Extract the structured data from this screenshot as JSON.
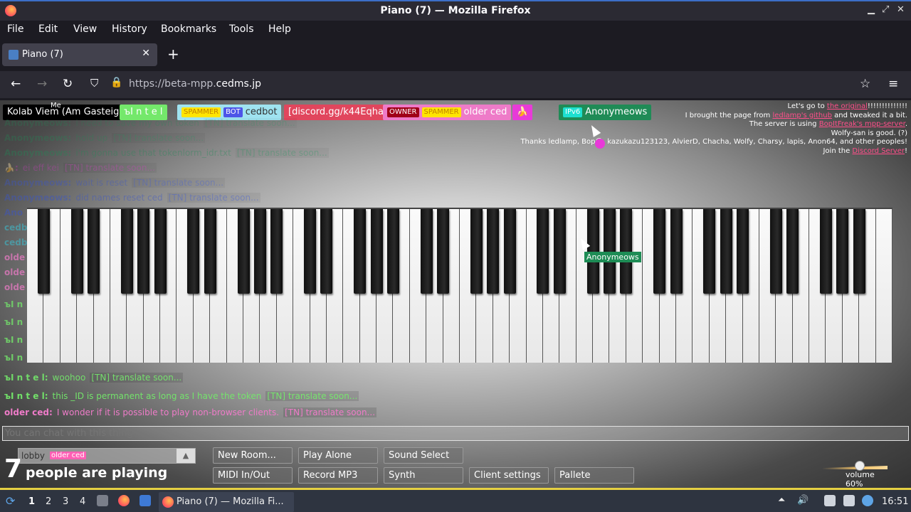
{
  "window": {
    "title": "Piano (7) — Mozilla Firefox"
  },
  "menu": [
    "File",
    "Edit",
    "View",
    "History",
    "Bookmarks",
    "Tools",
    "Help"
  ],
  "tab": {
    "label": "Piano (7)"
  },
  "url": {
    "prefix": "https://beta-mpp.",
    "domain": "cedms.jp"
  },
  "users": {
    "me_label": "Me",
    "list": [
      {
        "name": "Kolab Viem (Am Gasteig)",
        "tags": [],
        "bg": "#000000",
        "fg": "#ffffff"
      },
      {
        "name": "ъI n t e l",
        "tags": [],
        "bg": "#74e86b",
        "fg": "#ffffff"
      },
      {
        "name": "cedbot",
        "tags": [
          {
            "t": "SPAMMER",
            "bg": "#ffe500",
            "fg": "#c08000"
          },
          {
            "t": "BOT",
            "bg": "#4d55e8",
            "fg": "#ffffff"
          }
        ],
        "bg": "#9fe3f0",
        "fg": "#333333"
      },
      {
        "name": "[discord.gg/k44Eqha]",
        "tags": [],
        "bg": "#e1465d",
        "fg": "#ffffff"
      },
      {
        "name": "older ced",
        "tags": [
          {
            "t": "OWNER",
            "bg": "#a00018",
            "fg": "#ffffff"
          },
          {
            "t": "SPAMMER",
            "bg": "#ffe500",
            "fg": "#c08000"
          }
        ],
        "bg": "#ee7bc8",
        "fg": "#ffffff"
      },
      {
        "name": "🍌",
        "tags": [],
        "bg": "#e83ad8",
        "fg": "#ffffff"
      },
      {
        "name": "Anonymeows",
        "tags": [
          {
            "t": "IPv6",
            "bg": "#1de0d0",
            "fg": "#ffffff"
          }
        ],
        "bg": "#1f8b56",
        "fg": "#ffffff"
      }
    ]
  },
  "credits": {
    "l1_a": "Let's go to ",
    "l1_link": "the original",
    "l1_b": "!!!!!!!!!!!!!!",
    "l2_a": "I brought the page from ",
    "l2_link": "ledlamp's github",
    "l2_b": " and tweaked it a bit.",
    "l3_a": "The server is using ",
    "l3_link": "BopItFreak's mpp-server",
    "l4": "Wolfy-san is good. (?)",
    "l5": "Thanks ledlamp, Bop☺, kazukazu123123, AlvierD, Chacha, Wolfy, Charsy, lapis, Anon64, and other peoples!",
    "l6_a": "Join the ",
    "l6_link": "Discord Server",
    "l6_b": "!"
  },
  "chat": [
    {
      "name": "Anonymeows:",
      "msg": "i need to save my own token",
      "tn": "[TN] translate soon...",
      "color": "#1f8b56",
      "opacity": 0.25
    },
    {
      "name": "Anonymeows:",
      "msg": "hold up",
      "tn": "[TN] translate soon...",
      "color": "#1f8b56",
      "opacity": 0.3
    },
    {
      "name": "Anonymeows:",
      "msg": "i'm gonna use that tokenlorm_idr.txt",
      "tn": "[TN] translate soon...",
      "color": "#1f8b56",
      "opacity": 0.35
    },
    {
      "name": "🍌:",
      "msg": "ei eff kei",
      "tn": "[TN] translate soon...",
      "color": "#c23bb5",
      "opacity": 0.4
    },
    {
      "name": "Anonymeows:",
      "msg": "wait is reset",
      "tn": "[TN] translate soon...",
      "color": "#3a55c8",
      "opacity": 0.4
    },
    {
      "name": "Anonymeows:",
      "msg": "did names reset ced",
      "tn": "[TN] translate soon...",
      "color": "#3a55c8",
      "opacity": 0.45
    },
    {
      "name": "Ano",
      "msg": "",
      "tn": "",
      "color": "#3a55c8",
      "opacity": 0.5
    },
    {
      "name": "cedb",
      "msg": "",
      "tn": "",
      "color": "#3fb8c8",
      "opacity": 0.6
    },
    {
      "name": "cedb",
      "msg": "",
      "tn": "",
      "color": "#3fb8c8",
      "opacity": 0.6
    },
    {
      "name": "olde",
      "msg": "",
      "tn": "",
      "color": "#ee7bc8",
      "opacity": 0.7
    },
    {
      "name": "olde",
      "msg": "",
      "tn": "",
      "color": "#ee7bc8",
      "opacity": 0.7
    },
    {
      "name": "olde",
      "msg": "",
      "tn": "",
      "color": "#ee7bc8",
      "opacity": 0.7
    },
    {
      "name": "ъI n",
      "msg": "",
      "tn": "",
      "color": "#74e86b",
      "opacity": 0.75
    },
    {
      "name": "ъI n",
      "msg": "",
      "tn": "",
      "color": "#74e86b",
      "opacity": 0.75
    },
    {
      "name": "ъI n",
      "msg": "",
      "tn": "",
      "color": "#74e86b",
      "opacity": 0.8
    },
    {
      "name": "ъI n",
      "msg": "",
      "tn": "",
      "color": "#74e86b",
      "opacity": 0.8
    },
    {
      "name": "ъI n t e l:",
      "msg": "woohoo",
      "tn": "[TN] translate soon...",
      "color": "#74e86b",
      "opacity": 0.9
    },
    {
      "name": "ъI n t e l:",
      "msg": "this _ID is permanent as long as I have the token",
      "tn": "[TN] translate soon...",
      "color": "#74e86b",
      "opacity": 0.95
    },
    {
      "name": "older ced:",
      "msg": "I wonder if it is possible to play non-browser clients.",
      "tn": "[TN] translate soon...",
      "color": "#ee7bc8",
      "opacity": 1
    }
  ],
  "piano_cursor_name": "Anonymeows",
  "chat_input": {
    "placeholder": "You can chat with this thing."
  },
  "room": {
    "name": "lobby",
    "owner_tag": "older ced"
  },
  "playing": {
    "count": "7",
    "label": "people are playing"
  },
  "buttons": {
    "new_room": "New Room...",
    "play_alone": "Play Alone",
    "sound_select": "Sound Select",
    "midi": "MIDI In/Out",
    "record": "Record MP3",
    "synth": "Synth",
    "client_settings": "Client settings",
    "palette": "Pallete"
  },
  "volume": {
    "label": "volume 60%",
    "value": 0.6
  },
  "taskbar": {
    "workspaces": [
      "1",
      "2",
      "3",
      "4"
    ],
    "task": "Piano (7) — Mozilla Fi...",
    "clock": "16:51"
  }
}
